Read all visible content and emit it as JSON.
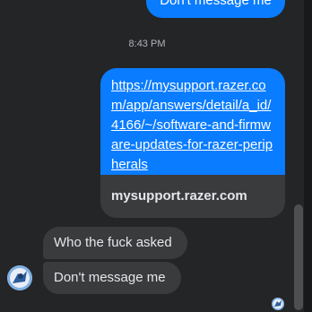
{
  "conversation": {
    "top_message": "Don't message me",
    "timestamp": "8:43 PM",
    "link_message": {
      "url": "https://mysupport.razer.com/app/answers/detail/a_id/4166/~/software-and-firmware-updates-for-razer-peripherals",
      "domain": "mysupport.razer.com"
    },
    "incoming": [
      {
        "text": "Who the fuck asked"
      },
      {
        "text": "Don't message me"
      }
    ]
  },
  "colors": {
    "background": "#242526",
    "outgoing_bubble": "#0a7cff",
    "incoming_bubble": "#3a3b3c",
    "text_primary": "#e4e6eb",
    "text_secondary": "#b0b3b8"
  },
  "icons": [
    "avatar",
    "read-receipt-avatar"
  ]
}
